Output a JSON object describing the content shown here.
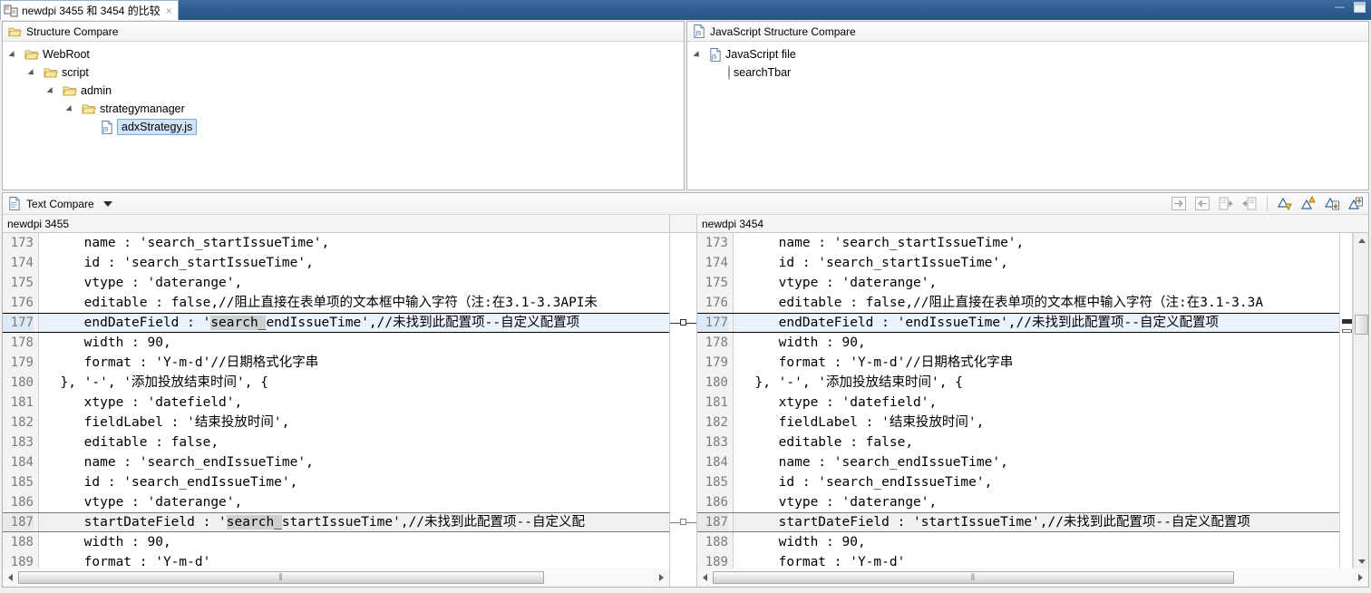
{
  "window": {
    "tab_title": "newdpi 3455 和 3454 的比较",
    "tab_close": "×",
    "minimize_label": "—",
    "maximize_label": "□"
  },
  "structure_compare": {
    "left": {
      "header": "Structure Compare",
      "tree": [
        {
          "label": "WebRoot",
          "depth": 0,
          "icon": "folder-icon",
          "expanded": true,
          "selected": false
        },
        {
          "label": "script",
          "depth": 1,
          "icon": "folder-icon",
          "expanded": true,
          "selected": false
        },
        {
          "label": "admin",
          "depth": 2,
          "icon": "folder-icon",
          "expanded": true,
          "selected": false
        },
        {
          "label": "strategymanager",
          "depth": 3,
          "icon": "folder-icon",
          "expanded": true,
          "selected": false
        },
        {
          "label": "adxStrategy.js",
          "depth": 4,
          "icon": "js-file-icon",
          "expanded": false,
          "selected": true
        }
      ]
    },
    "right": {
      "header": "JavaScript Structure Compare",
      "tree": [
        {
          "label": "JavaScript file",
          "depth": 0,
          "icon": "js-file-icon",
          "expanded": true,
          "selected": false
        },
        {
          "label": "searchTbar",
          "depth": 1,
          "icon": "member-dot-icon",
          "expanded": false,
          "selected": false
        }
      ]
    }
  },
  "text_compare": {
    "title": "Text Compare",
    "menu_icon": "chevron-down-icon",
    "toolbar_buttons": [
      {
        "name": "copy-all-left-to-right-icon",
        "label": "Copy All from Left to Right"
      },
      {
        "name": "copy-all-right-to-left-icon",
        "label": "Copy All from Right to Left"
      },
      {
        "name": "copy-current-change-left-to-right-icon",
        "label": "Copy Current Change from Left to Right"
      },
      {
        "name": "copy-current-change-right-to-left-icon",
        "label": "Copy Current Change from Right to Left"
      },
      {
        "name": "next-difference-icon",
        "label": "Select Next Difference"
      },
      {
        "name": "previous-difference-icon",
        "label": "Select Previous Difference"
      },
      {
        "name": "next-change-icon",
        "label": "Select Next Change"
      },
      {
        "name": "previous-change-icon",
        "label": "Select Previous Change"
      }
    ],
    "left_file_label": "newdpi 3455",
    "right_file_label": "newdpi 3454",
    "left_lines": [
      {
        "no": "173",
        "text": "     name : 'search_startIssueTime',",
        "diff": "none"
      },
      {
        "no": "174",
        "text": "     id : 'search_startIssueTime',",
        "diff": "none"
      },
      {
        "no": "175",
        "text": "     vtype : 'daterange',",
        "diff": "none"
      },
      {
        "no": "176",
        "text": "     editable : false,//阻止直接在表单项的文本框中输入字符（注:在3.1-3.3API未",
        "diff": "none"
      },
      {
        "no": "177",
        "text": "     endDateField : 'search_endIssueTime',//未找到此配置项--自定义配置项",
        "diff": "current",
        "highlight": "search_"
      },
      {
        "no": "178",
        "text": "     width : 90,",
        "diff": "none"
      },
      {
        "no": "179",
        "text": "     format : 'Y-m-d'//日期格式化字串",
        "diff": "none"
      },
      {
        "no": "180",
        "text": "  }, '-', '添加投放结束时间', {",
        "diff": "none"
      },
      {
        "no": "181",
        "text": "     xtype : 'datefield',",
        "diff": "none"
      },
      {
        "no": "182",
        "text": "     fieldLabel : '结束投放时间',",
        "diff": "none"
      },
      {
        "no": "183",
        "text": "     editable : false,",
        "diff": "none"
      },
      {
        "no": "184",
        "text": "     name : 'search_endIssueTime',",
        "diff": "none"
      },
      {
        "no": "185",
        "text": "     id : 'search_endIssueTime',",
        "diff": "none"
      },
      {
        "no": "186",
        "text": "     vtype : 'daterange',",
        "diff": "none"
      },
      {
        "no": "187",
        "text": "     startDateField : 'search_startIssueTime',//未找到此配置项--自定义配",
        "diff": "other",
        "highlight": "search_"
      },
      {
        "no": "188",
        "text": "     width : 90,",
        "diff": "none"
      },
      {
        "no": "189",
        "text": "     format : 'Y-m-d'",
        "diff": "none"
      }
    ],
    "right_lines": [
      {
        "no": "173",
        "text": "     name : 'search_startIssueTime',",
        "diff": "none"
      },
      {
        "no": "174",
        "text": "     id : 'search_startIssueTime',",
        "diff": "none"
      },
      {
        "no": "175",
        "text": "     vtype : 'daterange',",
        "diff": "none"
      },
      {
        "no": "176",
        "text": "     editable : false,//阻止直接在表单项的文本框中输入字符（注:在3.1-3.3A",
        "diff": "none"
      },
      {
        "no": "177",
        "text": "     endDateField : 'endIssueTime',//未找到此配置项--自定义配置项",
        "diff": "current"
      },
      {
        "no": "178",
        "text": "     width : 90,",
        "diff": "none"
      },
      {
        "no": "179",
        "text": "     format : 'Y-m-d'//日期格式化字串",
        "diff": "none"
      },
      {
        "no": "180",
        "text": "  }, '-', '添加投放结束时间', {",
        "diff": "none"
      },
      {
        "no": "181",
        "text": "     xtype : 'datefield',",
        "diff": "none"
      },
      {
        "no": "182",
        "text": "     fieldLabel : '结束投放时间',",
        "diff": "none"
      },
      {
        "no": "183",
        "text": "     editable : false,",
        "diff": "none"
      },
      {
        "no": "184",
        "text": "     name : 'search_endIssueTime',",
        "diff": "none"
      },
      {
        "no": "185",
        "text": "     id : 'search_endIssueTime',",
        "diff": "none"
      },
      {
        "no": "186",
        "text": "     vtype : 'daterange',",
        "diff": "none"
      },
      {
        "no": "187",
        "text": "     startDateField : 'startIssueTime',//未找到此配置项--自定义配置项",
        "diff": "other"
      },
      {
        "no": "188",
        "text": "     width : 90,",
        "diff": "none"
      },
      {
        "no": "189",
        "text": "     format : 'Y-m-d'",
        "diff": "none"
      }
    ],
    "scrollbar": {
      "left_thumb_glyph": "⦀",
      "right_thumb_glyph": "⦀"
    }
  },
  "colors": {
    "title_bar": "#2f5e91",
    "diff_current_bg": "#eaf2fb",
    "diff_other_bg": "#f1f1f1",
    "selection": "#cfe3f7",
    "token_highlight": "#cfcfcf"
  }
}
